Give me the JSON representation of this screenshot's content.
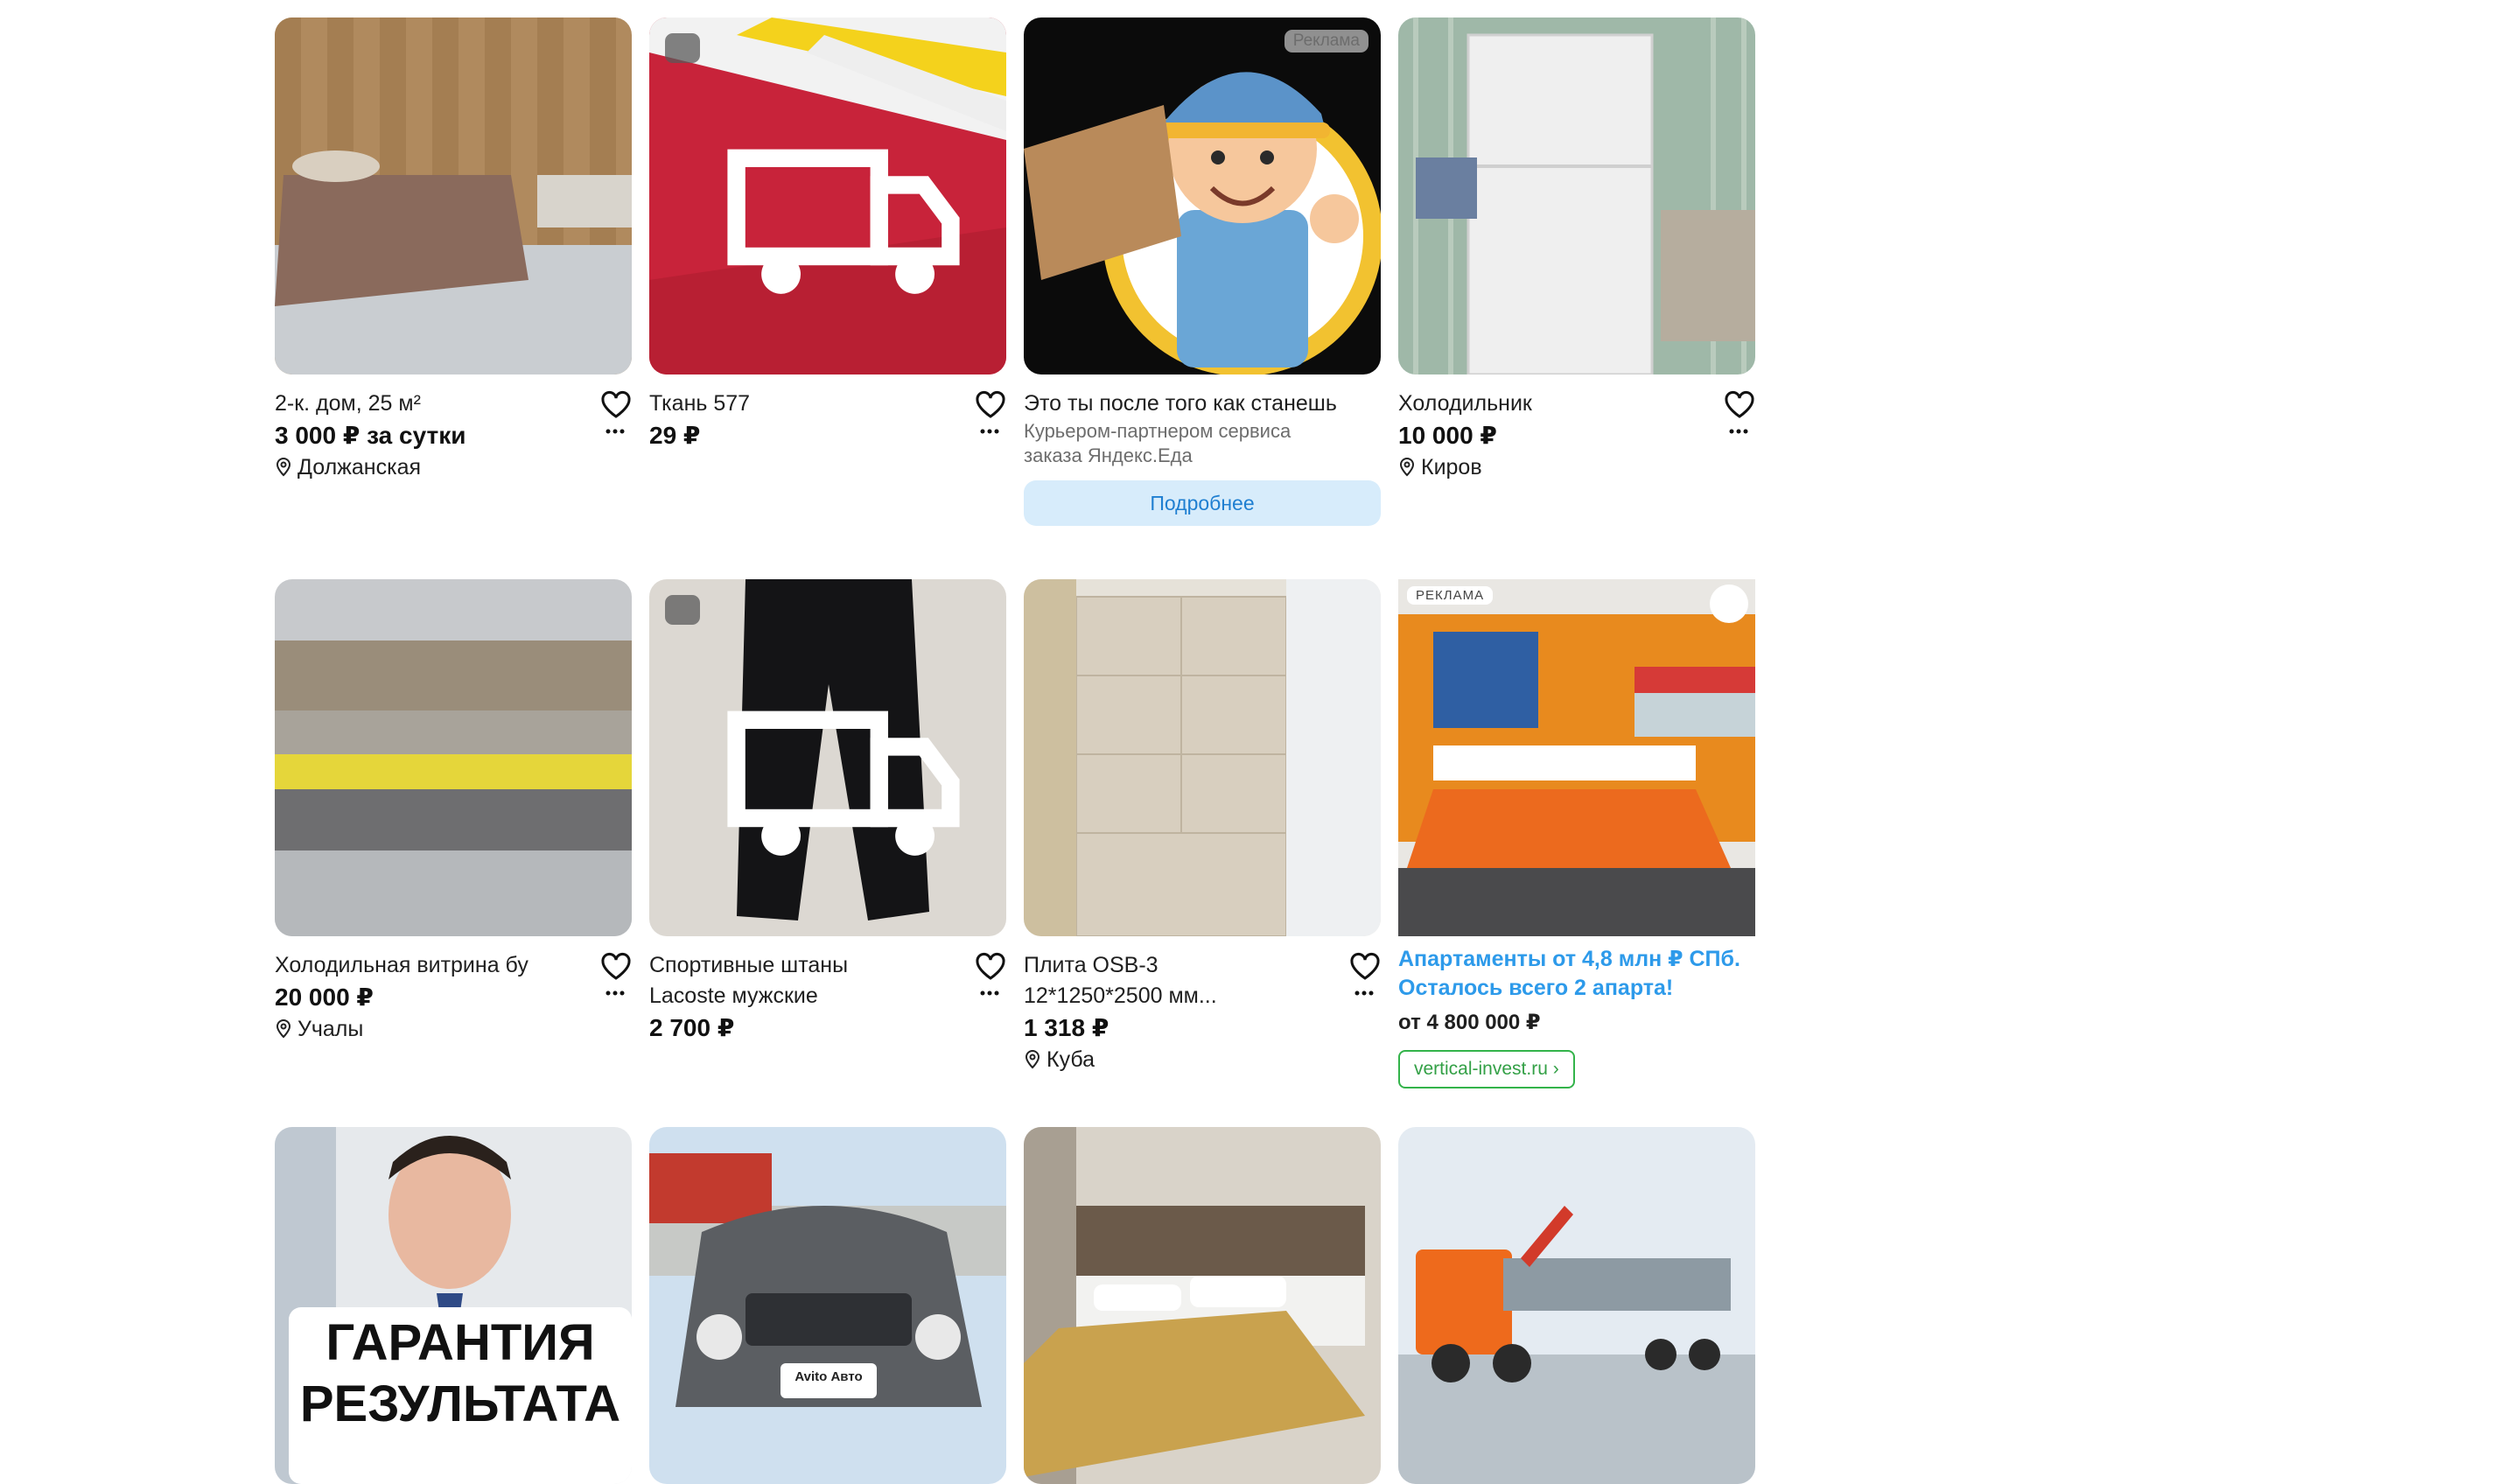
{
  "listings": [
    {
      "title": "2-к. дом, 25 м²",
      "price": "3 000 ₽ за сутки",
      "location": "Должанская"
    },
    {
      "title": "Ткань 577",
      "price": "29 ₽"
    },
    {
      "title": "Холодильник",
      "price": "10 000 ₽",
      "location": "Киров"
    },
    {
      "title": "Холодильная витрина бу",
      "price": "20 000 ₽",
      "location": "Учалы"
    },
    {
      "title_line1": "Спортивные штаны",
      "title_line2": "Lacoste мужские",
      "price": "2 700 ₽"
    },
    {
      "title_line1": "Плита OSB-3",
      "title_line2": "12*1250*2500 мм...",
      "price": "1 318 ₽",
      "location": "Куба"
    }
  ],
  "ad_yandex": {
    "badge": "Реклама",
    "title": "Это ты после того как станешь",
    "subtitle_line1": "Курьером-партнером сервиса",
    "subtitle_line2": "заказа Яндекс.Еда",
    "button": "Подробнее"
  },
  "ad_vertical": {
    "badge": "РЕКЛАМА",
    "title_line1": "Апартаменты от 4,8 млн ₽ СПб.",
    "title_line2": "Осталось всего 2 апарта!",
    "price": "от 4 800 000 ₽",
    "domain": "vertical-invest.ru ›"
  },
  "bottom_row": {
    "guarantee_line1": "ГАРАНТИЯ",
    "guarantee_line2": "РЕЗУЛЬТАТА",
    "avito_badge": "Avito Авто"
  },
  "colors": {
    "accent_blue": "#2d9aea",
    "cta_bg": "#d7ecfb",
    "green_domain": "#33b34a"
  }
}
